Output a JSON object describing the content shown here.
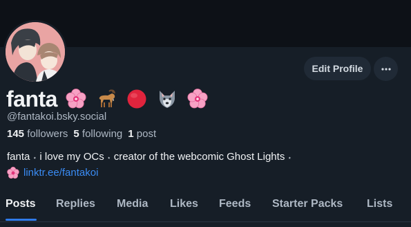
{
  "profile": {
    "display_name": "fanta",
    "name_emojis": [
      "cherry-blossom",
      "goat",
      "red-circle",
      "wolf",
      "cherry-blossom"
    ],
    "handle": "@fantakoi.bsky.social",
    "stats": {
      "followers_count": "145",
      "followers_label": "followers",
      "following_count": "5",
      "following_label": "following",
      "posts_count": "1",
      "posts_label": "post"
    },
    "bio": {
      "part1": "fanta",
      "part2": "i love my OCs",
      "part3": "creator of the webcomic Ghost Lights",
      "separator": "⋆",
      "link_text": "linktr.ee/fantakoi"
    }
  },
  "actions": {
    "edit_profile_label": "Edit Profile",
    "more_label": "···"
  },
  "tabs": [
    {
      "label": "Posts",
      "active": true
    },
    {
      "label": "Replies",
      "active": false
    },
    {
      "label": "Media",
      "active": false
    },
    {
      "label": "Likes",
      "active": false
    },
    {
      "label": "Feeds",
      "active": false
    },
    {
      "label": "Starter Packs",
      "active": false
    },
    {
      "label": "Lists",
      "active": false
    }
  ],
  "colors": {
    "background": "#161e27",
    "banner": "#0d1117",
    "accent": "#2f7bea",
    "link": "#3a8cf5",
    "muted_text": "#aeb8c4"
  }
}
